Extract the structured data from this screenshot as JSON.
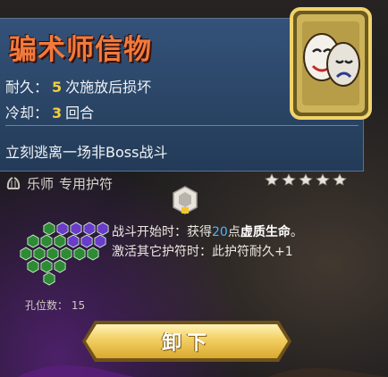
{
  "item": {
    "name": "骗术师信物",
    "durability": {
      "label": "耐久：",
      "value": "5",
      "suffix": "次施放后损坏"
    },
    "cooldown": {
      "label": "冷却：",
      "value": "3",
      "suffix": "回合"
    },
    "effect": "立刻逃离一场非Boss战斗",
    "icon": "theater-masks-icon"
  },
  "role": {
    "class": "乐师",
    "type": "专用护符"
  },
  "rarity_stars": 5,
  "description": {
    "line1_prefix": "战斗开始时：获得",
    "line1_value": "20",
    "line1_mid": "点",
    "line1_keyword": "虚质生命",
    "line1_end": "。",
    "line2": "激活其它护符时：此护符耐久+1"
  },
  "holes": {
    "label": "孔位数：",
    "value": "15"
  },
  "actions": {
    "unequip": "卸下"
  },
  "colors": {
    "title": "#f27a3d",
    "highlight_number": "#f5cf38",
    "blue_value": "#4db5ff",
    "panel": "#2a4566",
    "button": "#f2cf62"
  }
}
